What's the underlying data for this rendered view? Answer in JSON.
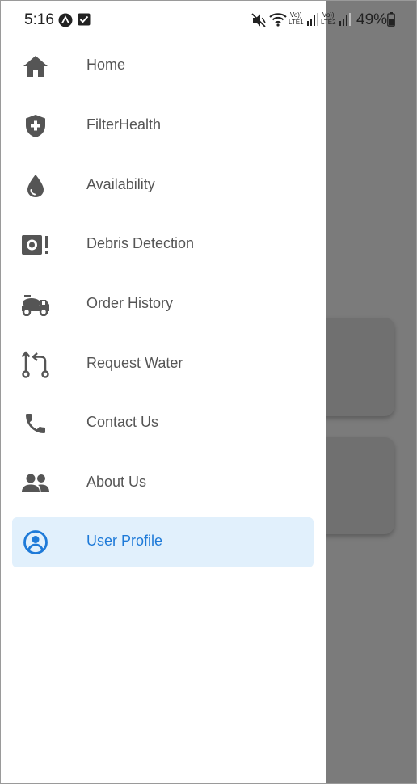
{
  "status_bar": {
    "time": "5:16",
    "battery": "49%",
    "lte1": "LTE1",
    "lte2": "LTE2",
    "volte": "Vo))"
  },
  "colors": {
    "icon_gray": "#555555",
    "active_blue": "#1e7ad8",
    "active_bg": "#e1f0fc",
    "scrim": "#7b7b7b"
  },
  "menu": {
    "items": [
      {
        "label": "Home",
        "icon": "home-icon"
      },
      {
        "label": "FilterHealth",
        "icon": "shield-plus-icon"
      },
      {
        "label": "Availability",
        "icon": "water-drop-icon"
      },
      {
        "label": "Debris Detection",
        "icon": "debris-alert-icon"
      },
      {
        "label": "Order History",
        "icon": "water-truck-icon"
      },
      {
        "label": "Request Water",
        "icon": "request-arrows-icon"
      },
      {
        "label": "Contact Us",
        "icon": "phone-icon"
      },
      {
        "label": "About Us",
        "icon": "people-icon"
      },
      {
        "label": "User Profile",
        "icon": "user-circle-icon",
        "selected": true
      }
    ]
  }
}
